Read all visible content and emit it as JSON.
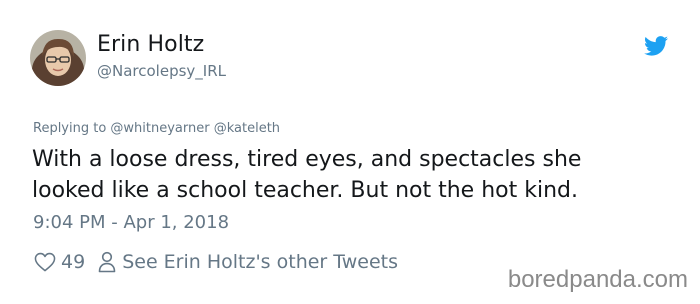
{
  "author": {
    "name": "Erin Holtz",
    "handle": "@Narcolepsy_IRL"
  },
  "tweet": {
    "replying_to": "Replying to @whitneyarner @kateleth",
    "lines": [
      "With a loose dress, tired eyes, and spectacles she",
      "looked like a school teacher. But not the hot kind."
    ],
    "timestamp": "9:04 PM - Apr 1, 2018"
  },
  "actions": {
    "like_count": "49",
    "other_tweets_label": "See Erin Holtz's other Tweets"
  },
  "watermark": "boredpanda.com",
  "icons": {
    "like": "heart-icon",
    "profile": "person-icon",
    "brand": "twitter-bird-icon"
  },
  "colors": {
    "brand": "#1da1f2",
    "secondary_text": "#657786",
    "primary_text": "#14171a"
  }
}
